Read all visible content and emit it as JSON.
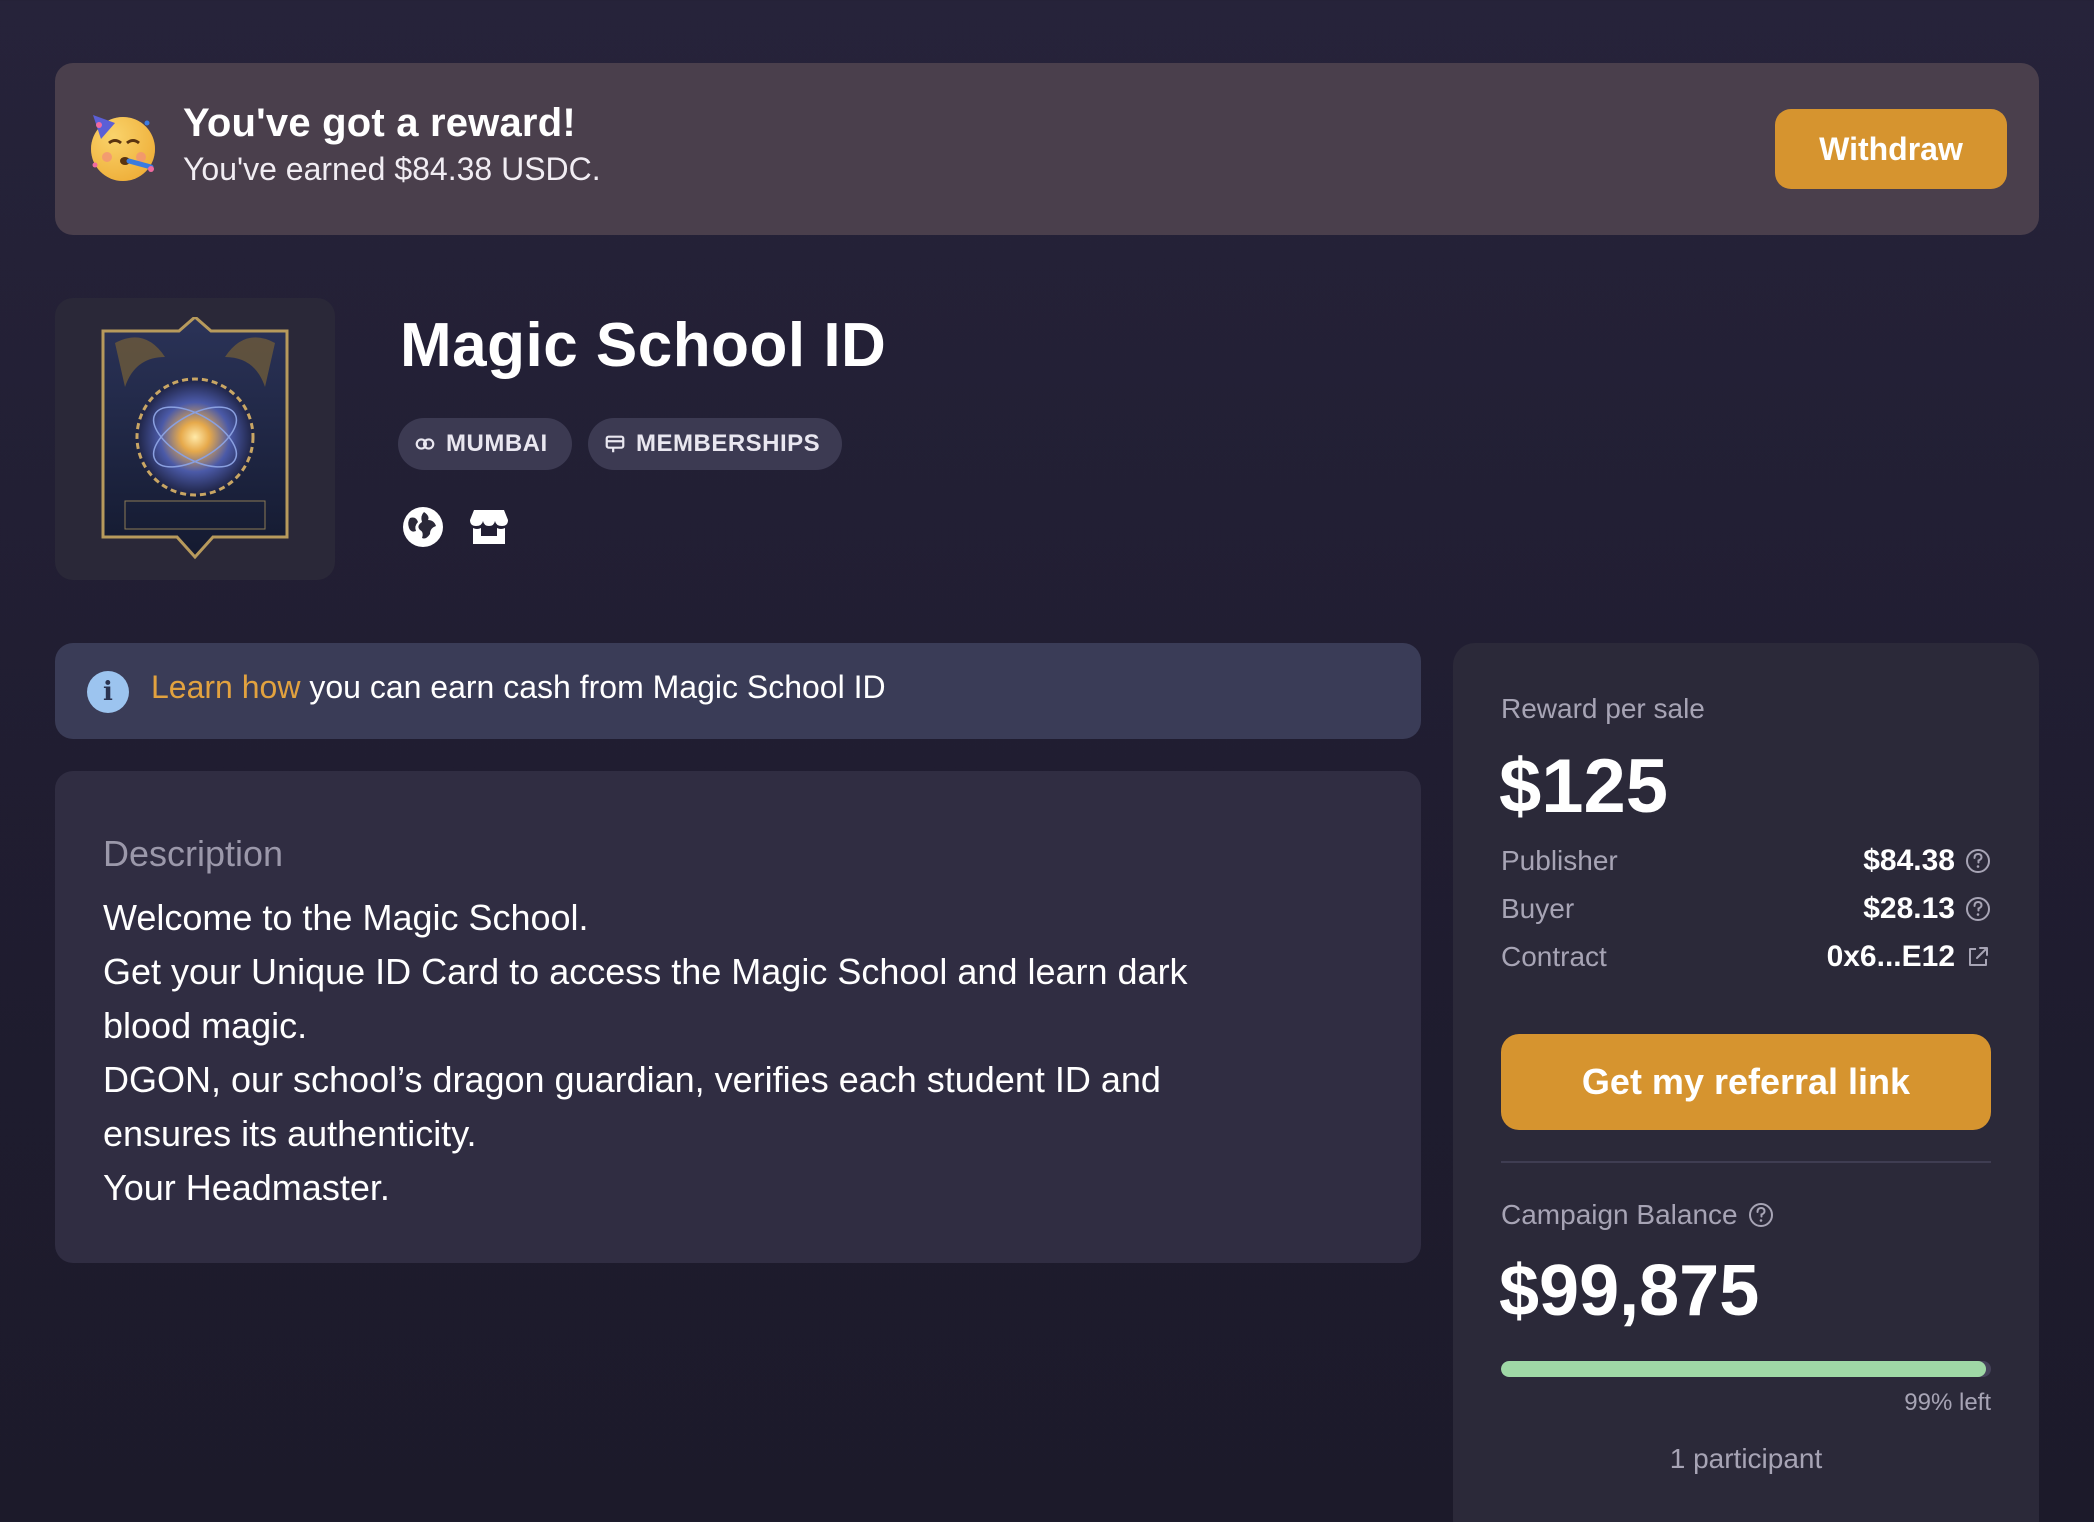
{
  "reward_banner": {
    "title": "You've got a reward!",
    "subtitle": "You've earned $84.38 USDC.",
    "withdraw_label": "Withdraw"
  },
  "product": {
    "title": "Magic School ID",
    "chips": [
      {
        "label": "MUMBAI",
        "icon": "link-icon"
      },
      {
        "label": "MEMBERSHIPS",
        "icon": "memberships-icon"
      }
    ],
    "links": [
      {
        "icon": "globe-icon"
      },
      {
        "icon": "store-icon"
      }
    ]
  },
  "info_bar": {
    "link_text": "Learn how",
    "text": " you can earn cash from Magic School ID"
  },
  "description": {
    "label": "Description",
    "lines": [
      "Welcome to the Magic School.",
      "Get your Unique ID Card to access the Magic School and learn dark",
      "blood magic.",
      "DGON, our school’s dragon guardian, verifies each student ID and",
      "ensures its authenticity.",
      "Your Headmaster."
    ]
  },
  "sidebar": {
    "reward_per_sale_label": "Reward per sale",
    "reward_per_sale_value": "$125",
    "split": [
      {
        "label": "Publisher",
        "value": "$84.38",
        "icon": "help-circle-icon"
      },
      {
        "label": "Buyer",
        "value": "$28.13",
        "icon": "help-circle-icon"
      },
      {
        "label": "Contract",
        "value": "0x6...E12",
        "icon": "external-link-icon"
      }
    ],
    "referral_button_label": "Get my referral link",
    "campaign_balance_label": "Campaign Balance",
    "campaign_balance_value": "$99,875",
    "progress_fraction": 0.99,
    "progress_caption": "99% left",
    "participants": "1 participant"
  },
  "colors": {
    "accent": "#d6942f",
    "progress": "#9fd8a6",
    "link": "#e2a23f"
  }
}
